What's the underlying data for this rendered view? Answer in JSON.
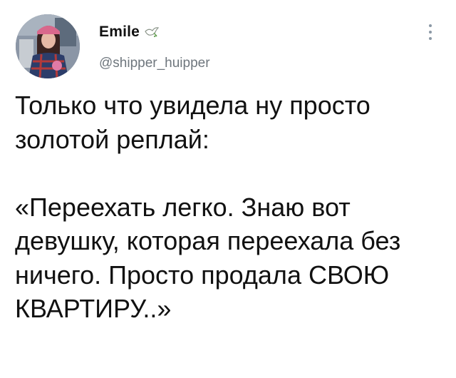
{
  "author": {
    "name": "Emile",
    "handle": "@shipper_huipper",
    "name_emoji_icon": "dove-of-peace-icon"
  },
  "tweet": {
    "text": "Только что увидела ну просто\nзолотой реплай:\n\n«Переехать легко. Знаю вот\nдевушку, которая переехала без\nничего. Просто продала СВОЮ\nКВАРТИРУ..»"
  },
  "menu": {
    "icon": "more-vertical-icon"
  },
  "colors": {
    "text": "#111111",
    "secondary": "#6e767d",
    "background": "#ffffff"
  }
}
